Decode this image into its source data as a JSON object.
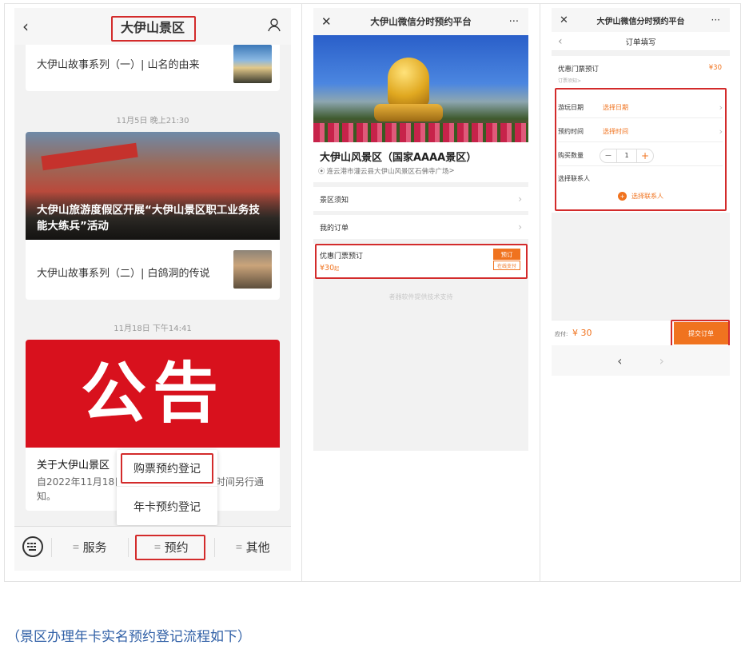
{
  "screen1": {
    "title": "大伊山景区",
    "story1": "大伊山故事系列（一）| 山名的由来",
    "date1": "11月5日 晚上21:30",
    "article_caption": "大伊山旅游度假区开展“大伊山景区职工业务技能大练兵”活动",
    "story2": "大伊山故事系列（二）| 白鸽洞的传说",
    "date2": "11月18日 下午14:41",
    "notice_banner": "公告",
    "notice_title": "关于大伊山景区",
    "notice_body": "自2022年11月18日",
    "notice_body_tail": "时间另行通",
    "notice_body_end": "知。",
    "popup_item1": "购票预约登记",
    "popup_item2": "年卡预约登记",
    "tab_service": "服务",
    "tab_book": "预约",
    "tab_other": "其他",
    "menu_prefix": "≡"
  },
  "screen2": {
    "title": "大伊山微信分时预约平台",
    "scenic_name": "大伊山风景区（国家AAAA景区）",
    "address": "连云港市灌云县大伊山风景区石佛寺广场",
    "row_notice": "景区须知",
    "row_orders": "我的订单",
    "ticket_name": "优惠门票预订",
    "ticket_price": "¥30",
    "ticket_price_suffix": "起",
    "btn_book": "预订",
    "btn_pay": "在线支付",
    "support": "者器软件提供技术支持"
  },
  "screen3": {
    "title": "大伊山微信分时预约平台",
    "subtitle": "订单填写",
    "ticket_name": "优惠门票预订",
    "ticket_price": "¥30",
    "ticket_note": "订票须知>",
    "label_date": "游玩日期",
    "value_date": "选择日期",
    "label_time": "预约时间",
    "value_time": "选择时间",
    "label_qty": "购买数量",
    "qty": "1",
    "label_contact": "选择联系人",
    "value_contact": "选择联系人",
    "pay_label": "应付:",
    "pay_amount": "¥ 30",
    "submit": "提交订单"
  },
  "caption": "（景区办理年卡实名预约登记流程如下）",
  "colors": {
    "accent": "#f0731f",
    "highlight": "#d32b2b",
    "link": "#2f5fa6"
  }
}
